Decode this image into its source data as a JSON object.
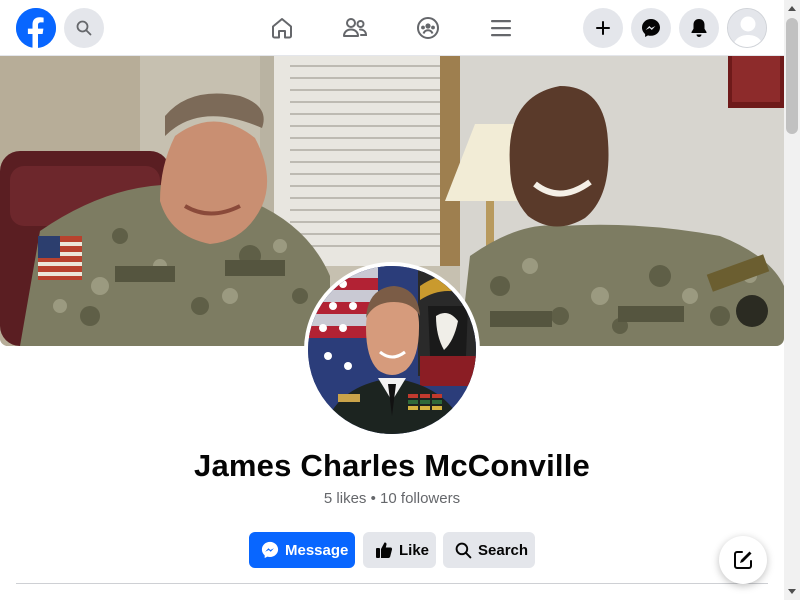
{
  "profile": {
    "name": "James Charles McConville",
    "likes": "5 likes",
    "separator": "•",
    "followers": "10 followers"
  },
  "actions": {
    "message_label": "Message",
    "like_label": "Like",
    "search_label": "Search"
  },
  "colors": {
    "brand": "#0866ff",
    "button_gray": "#e4e6eb",
    "text_secondary": "#65676b"
  },
  "icons": [
    "facebook-logo-icon",
    "search-icon",
    "home-icon",
    "friends-icon",
    "groups-icon",
    "menu-icon",
    "plus-icon",
    "messenger-icon",
    "bell-icon",
    "compose-icon"
  ]
}
